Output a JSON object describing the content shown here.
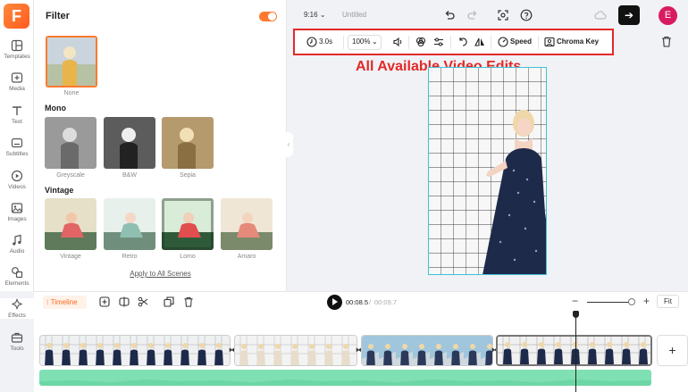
{
  "app": {
    "logo_letter": "F"
  },
  "sidebar": {
    "items": [
      {
        "label": "Templates",
        "icon": "templates-icon"
      },
      {
        "label": "Media",
        "icon": "media-icon"
      },
      {
        "label": "Text",
        "icon": "text-icon"
      },
      {
        "label": "Subtitles",
        "icon": "subtitles-icon"
      },
      {
        "label": "Videos",
        "icon": "videos-icon"
      },
      {
        "label": "Images",
        "icon": "images-icon"
      },
      {
        "label": "Audio",
        "icon": "audio-icon"
      },
      {
        "label": "Elements",
        "icon": "elements-icon"
      },
      {
        "label": "Effects",
        "icon": "effects-icon"
      },
      {
        "label": "Tools",
        "icon": "tools-icon"
      }
    ]
  },
  "filter_panel": {
    "title": "Filter",
    "enabled": true,
    "none_label": "None",
    "sections": [
      {
        "title": "Mono",
        "items": [
          "Greyscale",
          "B&W",
          "Sepia"
        ]
      },
      {
        "title": "Vintage",
        "items": [
          "Vintage",
          "Retro",
          "Lomo",
          "Amaro"
        ]
      }
    ],
    "apply_all": "Apply to All Scenes"
  },
  "topbar": {
    "aspect_ratio": "9:16",
    "project_title": "Untitled"
  },
  "edit_toolbar": {
    "duration": "3.0s",
    "zoom": "100%",
    "speed": "Speed",
    "chroma_key": "Chroma Key"
  },
  "annotation": "All Available Video Edits",
  "timeline": {
    "tab_label": "Timeline",
    "current_time": "00:08.5",
    "separator": "/",
    "total_time": "00:09.7",
    "fit_label": "Fit",
    "clip_count": 4
  },
  "user": {
    "initial": "E"
  },
  "colors": {
    "accent": "#ff7a2e",
    "annotation": "#e32828",
    "audio": "#7fe0b3",
    "preview_border": "#3fc2d6"
  }
}
